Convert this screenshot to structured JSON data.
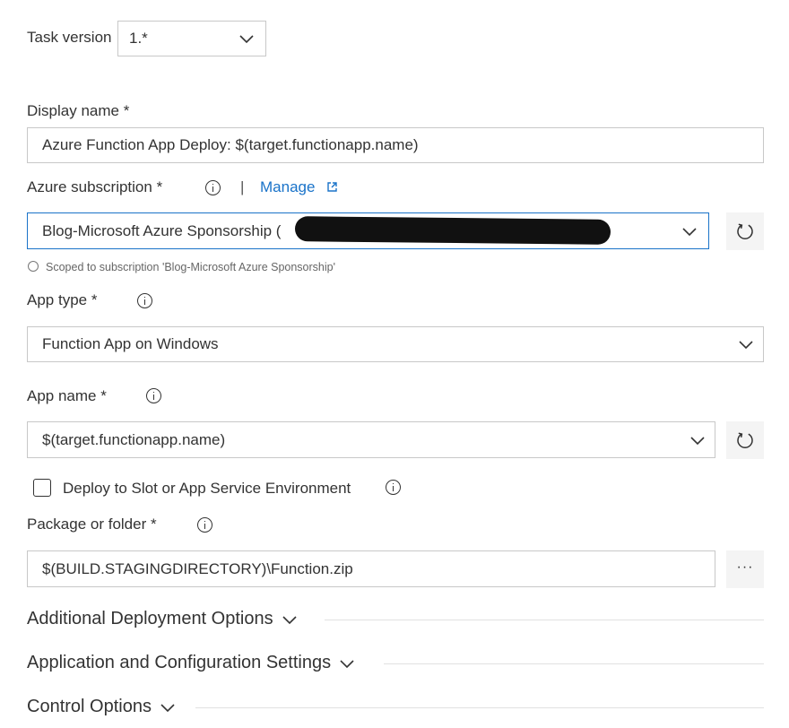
{
  "task_version": {
    "label": "Task version",
    "value": "1.*"
  },
  "display_name": {
    "label": "Display name *",
    "value": "Azure Function App Deploy: $(target.functionapp.name)"
  },
  "azure_subscription": {
    "label": "Azure subscription *",
    "separator": "|",
    "manage_label": "Manage",
    "value": "Blog-Microsoft Azure Sponsorship (",
    "scope_note": "Scoped to subscription 'Blog-Microsoft Azure Sponsorship'",
    "accent_color": "#1a73c9",
    "redaction_color": "#111111"
  },
  "app_type": {
    "label": "App type *",
    "value": "Function App on Windows"
  },
  "app_name": {
    "label": "App name *",
    "value": "$(target.functionapp.name)"
  },
  "deploy_slot": {
    "label": "Deploy to Slot or App Service Environment",
    "checked": false
  },
  "package": {
    "label": "Package or folder *",
    "value": "$(BUILD.STAGINGDIRECTORY)\\Function.zip",
    "browse_label": "···"
  },
  "sections": {
    "additional": "Additional Deployment Options",
    "application": "Application and Configuration Settings",
    "control": "Control Options"
  },
  "icons": {
    "info": "info-icon",
    "chevron": "chevron-down-icon",
    "refresh": "refresh-icon",
    "external": "external-link-icon"
  }
}
